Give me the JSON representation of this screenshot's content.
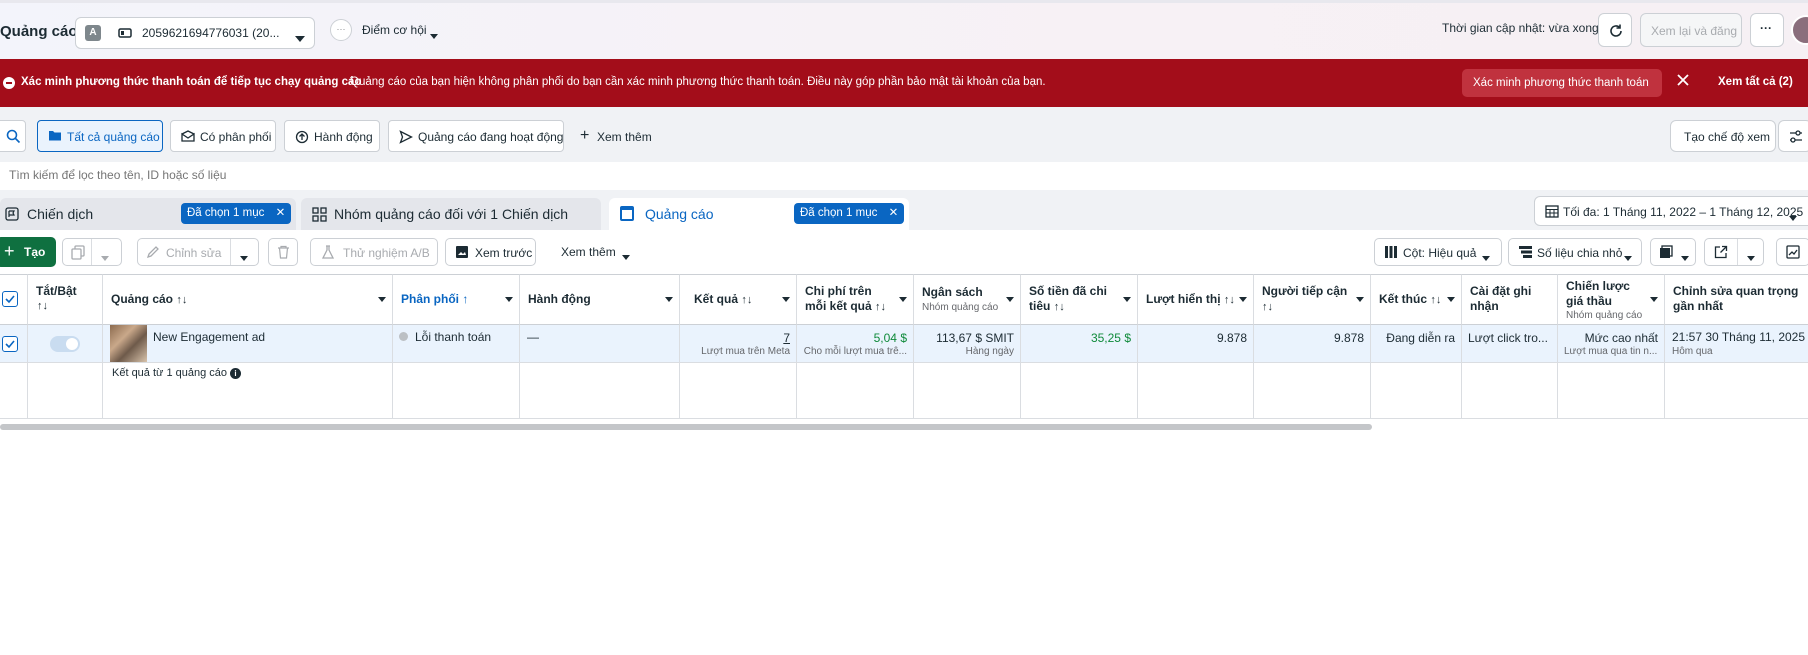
{
  "header": {
    "title": "Quảng cáo",
    "account_letter": "A",
    "account_id": "2059621694776031 (20...",
    "opportunity_label": "Điểm cơ hội",
    "updated_text": "Thời gian cập nhật: vừa xong",
    "review_publish": "Xem lại và đăng"
  },
  "banner": {
    "title": "Xác minh phương thức thanh toán để tiếp tục chạy quảng cáo",
    "message": "Quảng cáo của bạn hiện không phân phối do bạn cần xác minh phương thức thanh toán. Điều này góp phần bảo mật tài khoản của bạn.",
    "verify_button": "Xác minh phương thức thanh toán",
    "see_all": "Xem tất cả (2)"
  },
  "filters": {
    "chips": [
      "Tất cả quảng cáo",
      "Có phân phối",
      "Hành động",
      "Quảng cáo đang hoạt động"
    ],
    "see_more": "Xem thêm",
    "create_view": "Tạo chế độ xem",
    "search_placeholder": "Tìm kiếm để lọc theo tên, ID hoặc số liệu"
  },
  "tabs": {
    "campaign": "Chiến dịch",
    "campaign_badge": "Đã chọn 1 mục",
    "adset": "Nhóm quảng cáo đối với 1 Chiến dịch",
    "ads": "Quảng cáo",
    "ads_badge": "Đã chọn 1 mục",
    "date_range": "Tối đa: 1 Tháng 11, 2022 – 1 Tháng 12, 2025"
  },
  "toolbar": {
    "create": "Tạo",
    "edit": "Chỉnh sửa",
    "ab_test": "Thử nghiệm A/B",
    "preview": "Xem trước",
    "more": "Xem thêm",
    "columns": "Cột: Hiệu quả",
    "breakdown": "Số liệu chia nhỏ"
  },
  "columns": [
    {
      "label": "Tắt/Bật",
      "sub": ""
    },
    {
      "label": "Quảng cáo",
      "sub": ""
    },
    {
      "label": "Phân phối",
      "sub": ""
    },
    {
      "label": "Hành động",
      "sub": ""
    },
    {
      "label": "Kết quả",
      "sub": ""
    },
    {
      "label": "Chi phí trên mỗi kết quả",
      "sub": ""
    },
    {
      "label": "Ngân sách",
      "sub": "Nhóm quảng cáo"
    },
    {
      "label": "Số tiền đã chi tiêu",
      "sub": ""
    },
    {
      "label": "Lượt hiển thị",
      "sub": ""
    },
    {
      "label": "Người tiếp cận",
      "sub": ""
    },
    {
      "label": "Kết thúc",
      "sub": ""
    },
    {
      "label": "Cài đặt ghi nhận",
      "sub": ""
    },
    {
      "label": "Chiến lược giá thầu",
      "sub": "Nhóm quảng cáo"
    },
    {
      "label": "Chỉnh sửa quan trọng gần nhất",
      "sub": ""
    }
  ],
  "row": {
    "ad_name": "New Engagement ad",
    "delivery": "Lỗi thanh toán",
    "actions": "—",
    "results": "7",
    "results_sub": "Lượt mua trên Meta",
    "cost_per_result": "5,04 $",
    "cost_per_result_sub": "Cho mỗi lượt mua trê...",
    "budget": "113,67 $ SMIT",
    "budget_sub": "Hàng ngày",
    "amount_spent": "35,25 $",
    "impressions": "9.878",
    "reach": "9.878",
    "ends": "Đang diễn ra",
    "attribution": "Lượt click tro...",
    "bid_strategy": "Mức cao nhất",
    "bid_strategy_sub": "Lượt mua qua tin n...",
    "last_edit": "21:57 30 Tháng 11, 2025",
    "last_edit_sub": "Hôm qua"
  },
  "footer": {
    "summary": "Kết quả từ 1 quảng cáo"
  },
  "colors": {
    "accent": "#0a66c2",
    "banner": "#a30d1a",
    "green": "#0f8a3a"
  }
}
